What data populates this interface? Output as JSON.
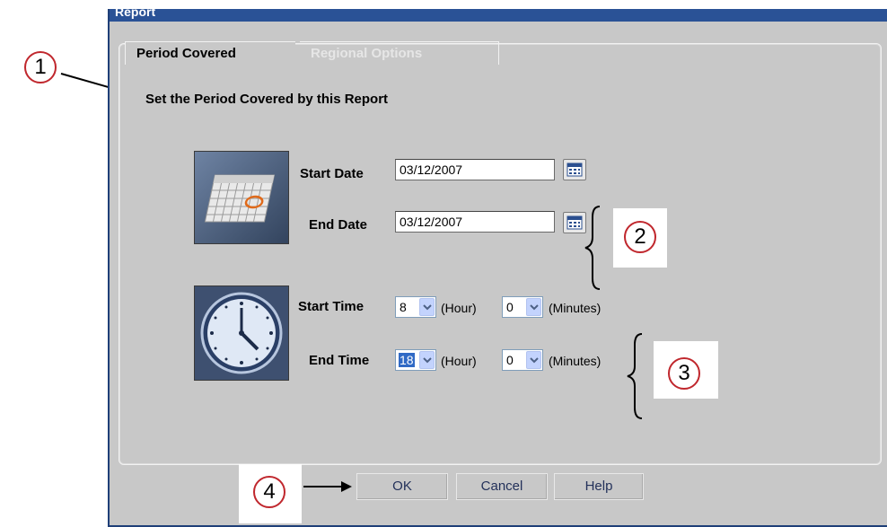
{
  "window": {
    "title": "Report"
  },
  "tabs": [
    {
      "label": "Period Covered",
      "active": true
    },
    {
      "label": "Regional Options",
      "active": false
    }
  ],
  "heading": "Set the Period Covered by this Report",
  "dates": {
    "start_label": "Start Date",
    "start_value": "03/12/2007",
    "end_label": "End Date",
    "end_value": "03/12/2007",
    "calendar_icon": "calendar-icon"
  },
  "times": {
    "start_label": "Start Time",
    "start_hour": "8",
    "start_minutes": "0",
    "end_label": "End Time",
    "end_hour": "18",
    "end_minutes": "0",
    "hour_unit": "(Hour)",
    "minutes_unit": "(Minutes)"
  },
  "buttons": {
    "ok": "OK",
    "cancel": "Cancel",
    "help": "Help"
  },
  "callouts": [
    "1",
    "2",
    "3",
    "4"
  ],
  "colors": {
    "titlebar": "#2a5296",
    "dialog_bg": "#c8c8c8",
    "callout_ring": "#c0272d",
    "selection": "#316ac5"
  }
}
